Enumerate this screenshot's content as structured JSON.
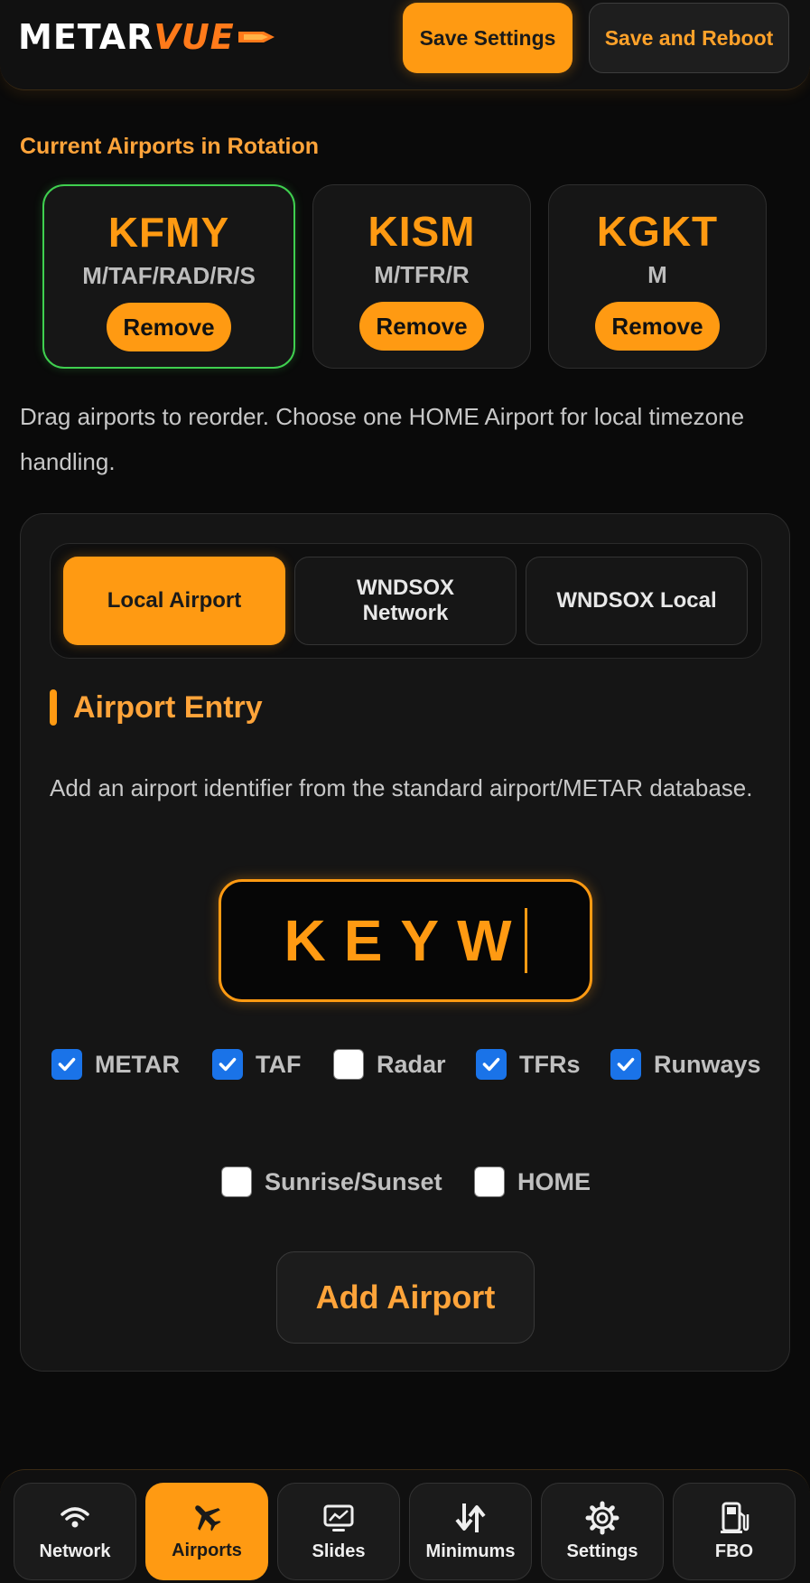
{
  "header": {
    "logo_main": "METAR",
    "logo_accent": "VUE",
    "save_label": "Save Settings",
    "reboot_label": "Save and Reboot"
  },
  "rotation": {
    "title": "Current Airports in Rotation",
    "airports": [
      {
        "code": "KFMY",
        "layers": "M/TAF/RAD/R/S",
        "remove_label": "Remove",
        "home": true
      },
      {
        "code": "KISM",
        "layers": "M/TFR/R",
        "remove_label": "Remove",
        "home": false
      },
      {
        "code": "KGKT",
        "layers": "M",
        "remove_label": "Remove",
        "home": false
      }
    ],
    "helper": "Drag airports to reorder. Choose one HOME Airport for local timezone handling."
  },
  "tabs": [
    {
      "label": "Local Airport",
      "active": true
    },
    {
      "label": "WNDSOX Network",
      "active": false
    },
    {
      "label": "WNDSOX Local",
      "active": false
    }
  ],
  "entry": {
    "title": "Airport Entry",
    "description": "Add an airport identifier from the standard airport/METAR database.",
    "identifier_value": "KEYW",
    "options": [
      {
        "label": "METAR",
        "checked": true
      },
      {
        "label": "TAF",
        "checked": true
      },
      {
        "label": "Radar",
        "checked": false
      },
      {
        "label": "TFRs",
        "checked": true
      },
      {
        "label": "Runways",
        "checked": true
      },
      {
        "label": "Sunrise/Sunset",
        "checked": false
      },
      {
        "label": "HOME",
        "checked": false
      }
    ],
    "add_label": "Add Airport"
  },
  "nav": [
    {
      "label": "Network",
      "icon": "wifi-icon",
      "active": false
    },
    {
      "label": "Airports",
      "icon": "airplane-icon",
      "active": true
    },
    {
      "label": "Slides",
      "icon": "monitor-icon",
      "active": false
    },
    {
      "label": "Minimums",
      "icon": "arrows-updown-icon",
      "active": false
    },
    {
      "label": "Settings",
      "icon": "gear-icon",
      "active": false
    },
    {
      "label": "FBO",
      "icon": "fuel-pump-icon",
      "active": false
    }
  ],
  "colors": {
    "accent": "#ff9a12",
    "home_border": "#3fcf4f",
    "checkbox_on": "#1a73e8"
  }
}
